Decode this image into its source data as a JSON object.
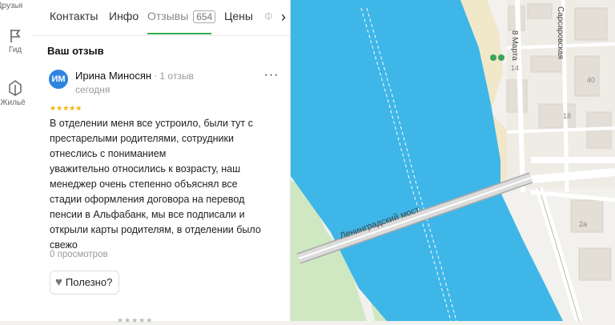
{
  "rail": {
    "items": [
      {
        "label": "Друзья",
        "icon": "friends-icon"
      },
      {
        "label": "Гид",
        "icon": "flag-icon"
      },
      {
        "label": "Жильё",
        "icon": "housing-icon"
      }
    ]
  },
  "tabs": [
    {
      "label": "Контакты"
    },
    {
      "label": "Инфо"
    },
    {
      "label": "Отзывы",
      "count": "654",
      "active": true
    },
    {
      "label": "Цены"
    },
    {
      "label": "Ф"
    }
  ],
  "tabs_next_icon": "chevron-right-icon",
  "section_title": "Ваш отзыв",
  "review": {
    "avatar_initials": "ИМ",
    "avatar_color": "#2f84e0",
    "author": "Ирина Миносян",
    "author_reviews": "1 отзыв",
    "date": "сегодня",
    "rating_stars": 5,
    "text": "В отделении меня все устроило, были тут с\nпрестарелыми родителями, сотрудники\nотнеслись с пониманием\nуважительно относились к возрасту, наш\nменеджер очень степенно объяснял все\nстадии оформления договора на перевод\nпенсии в Альфабанк, мы все подписали и\nоткрыли карты родителям, в отделении было\nсвежо",
    "views": "0 просмотров",
    "useful_label": "Полезно?"
  },
  "map": {
    "bridge_label": "Ленинградский мост",
    "street_label_1": "8 Марта",
    "street_label_2": "Сарсаровская",
    "building_numbers": [
      "14",
      "40",
      "18",
      "2а"
    ],
    "colors": {
      "water": "#3fb6e8",
      "land": "#f2f1ee",
      "park": "#cfe8c2",
      "sand": "#f1e7c9",
      "road": "#ffffff",
      "bridge": "#c8c8c8"
    }
  }
}
